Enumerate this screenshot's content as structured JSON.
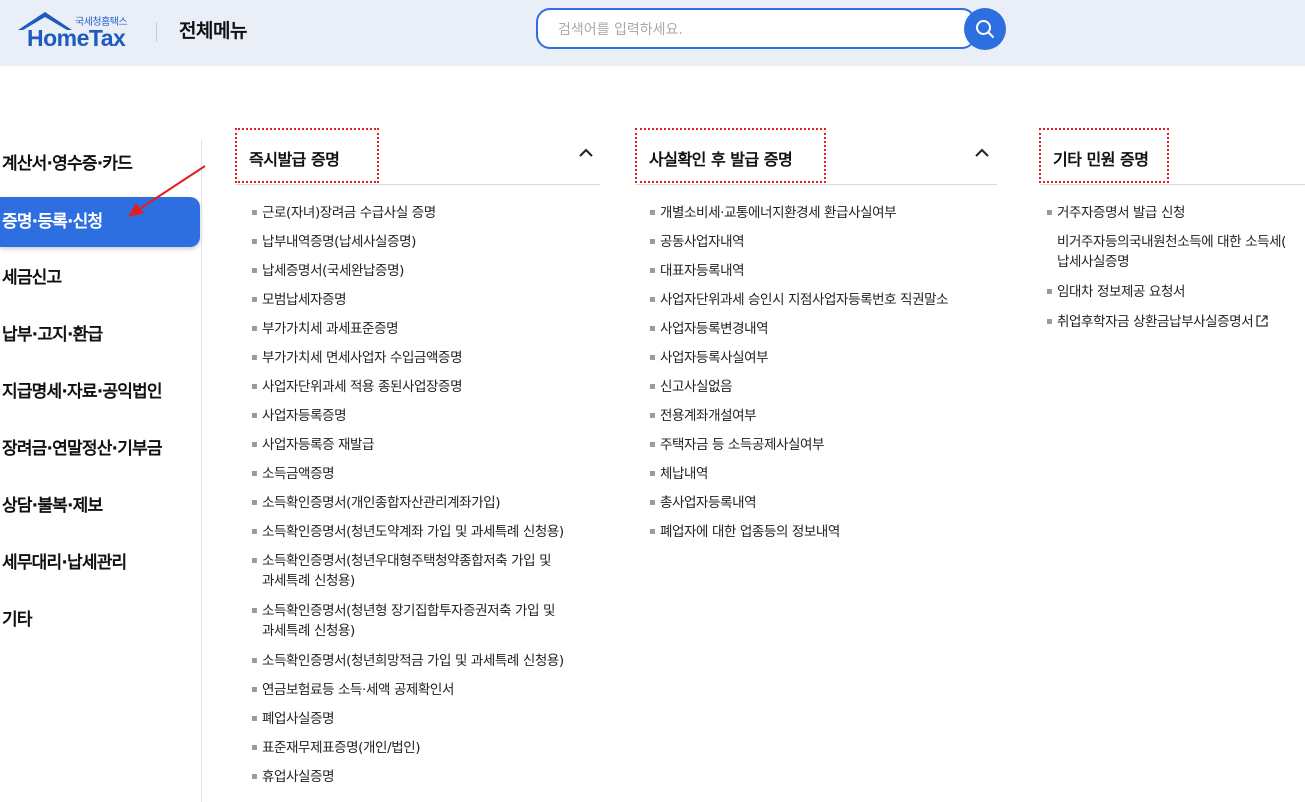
{
  "header": {
    "logo_sub": "국세청홈택스",
    "logo_main": "HomeTax",
    "page_title": "전체메뉴",
    "search_placeholder": "검색어를 입력하세요."
  },
  "sidebar": {
    "items": [
      {
        "label": "계산서·영수증·카드",
        "active": false
      },
      {
        "label": "증명·등록·신청",
        "active": true
      },
      {
        "label": "세금신고",
        "active": false
      },
      {
        "label": "납부·고지·환급",
        "active": false
      },
      {
        "label": "지급명세·자료·공익법인",
        "active": false
      },
      {
        "label": "장려금·연말정산·기부금",
        "active": false
      },
      {
        "label": "상담·불복·제보",
        "active": false
      },
      {
        "label": "세무대리·납세관리",
        "active": false
      },
      {
        "label": "기타",
        "active": false
      }
    ]
  },
  "columns": [
    {
      "title": "즉시발급 증명",
      "items": [
        "근로(자녀)장려금 수급사실 증명",
        "납부내역증명(납세사실증명)",
        "납세증명서(국세완납증명)",
        "모범납세자증명",
        "부가가치세 과세표준증명",
        "부가가치세 면세사업자 수입금액증명",
        "사업자단위과세 적용 종된사업장증명",
        "사업자등록증명",
        "사업자등록증 재발급",
        "소득금액증명",
        "소득확인증명서(개인종합자산관리계좌가입)",
        "소득확인증명서(청년도약계좌 가입 및 과세특례 신청용)",
        [
          "소득확인증명서(청년우대형주택청약종합저축 가입 및",
          "과세특례 신청용)"
        ],
        [
          "소득확인증명서(청년형 장기집합투자증권저축 가입 및",
          "과세특례 신청용)"
        ],
        "소득확인증명서(청년희망적금 가입 및 과세특례 신청용)",
        "연금보험료등 소득·세액 공제확인서",
        "폐업사실증명",
        "표준재무제표증명(개인/법인)",
        "휴업사실증명"
      ]
    },
    {
      "title": "사실확인 후 발급 증명",
      "items": [
        "개별소비세·교통에너지환경세 환급사실여부",
        "공동사업자내역",
        "대표자등록내역",
        "사업자단위과세 승인시 지점사업자등록번호 직권말소",
        "사업자등록변경내역",
        "사업자등록사실여부",
        "신고사실없음",
        "전용계좌개설여부",
        "주택자금 등 소득공제사실여부",
        "체납내역",
        "총사업자등록내역",
        "폐업자에 대한 업종등의 정보내역"
      ]
    },
    {
      "title": "기타 민원 증명",
      "items": [
        "거주자증명서 발급 신청",
        [
          "비거주자등의국내원천소득에 대한 소득세(",
          "납세사실증명"
        ],
        "임대차 정보제공 요청서",
        "취업후학자금 상환금납부사실증명서"
      ]
    }
  ],
  "colors": {
    "accent": "#2d6fe0",
    "highlight": "#e31e1e"
  },
  "icons": [
    "search-icon",
    "chevron-up-icon",
    "external-link-icon",
    "red-arrow"
  ]
}
